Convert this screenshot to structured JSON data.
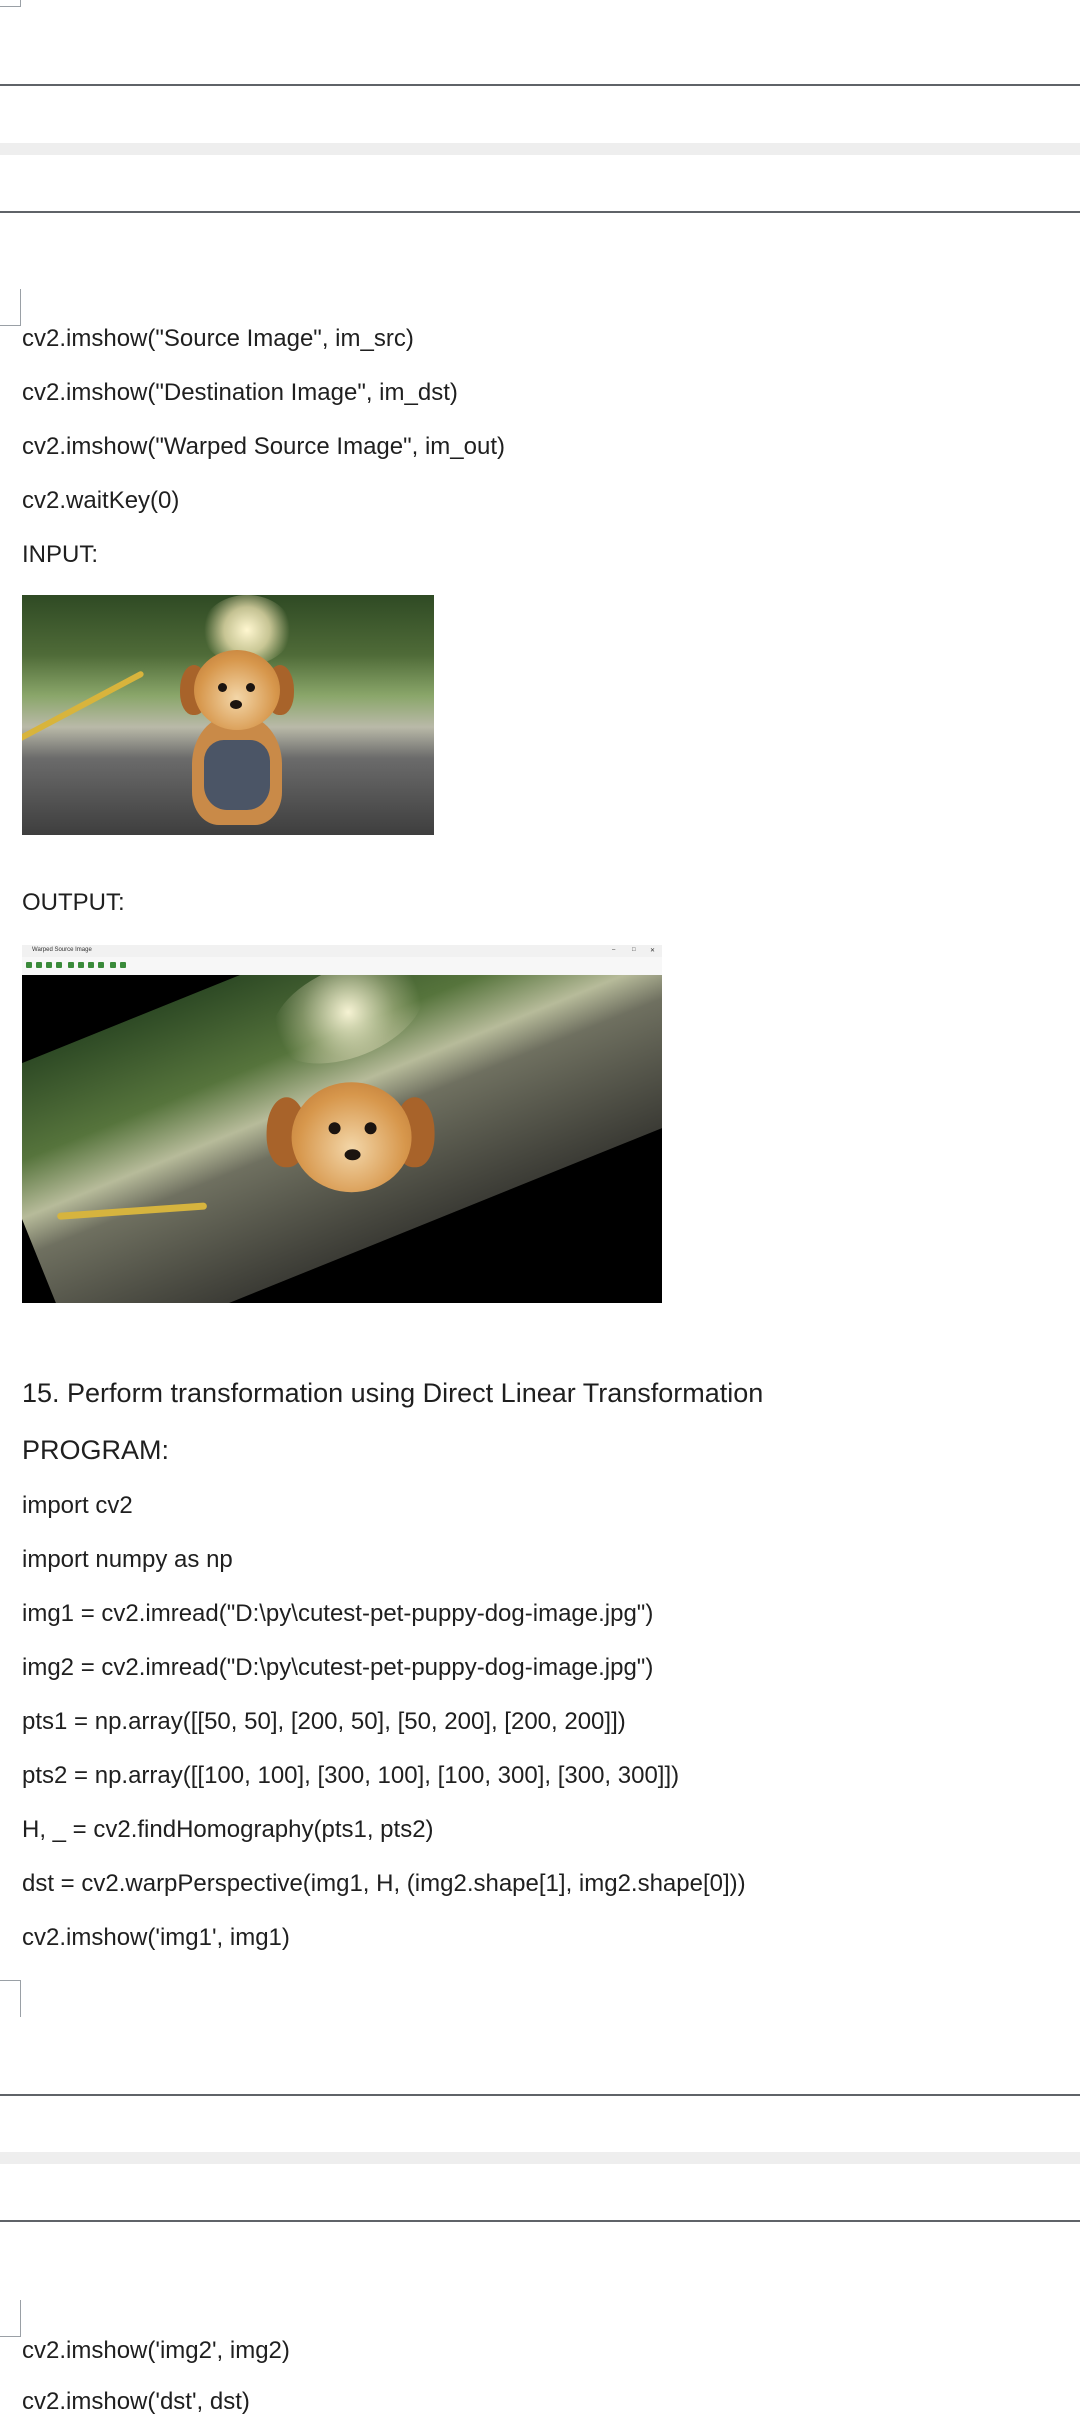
{
  "page1": {
    "lines": [
      "cv2.imshow(\"Source Image\", im_src)",
      "cv2.imshow(\"Destination Image\", im_dst)",
      "cv2.imshow(\"Warped Source Image\", im_out)",
      "cv2.waitKey(0)",
      "INPUT:"
    ],
    "output_label": "OUTPUT:",
    "window": {
      "title": "Warped Source Image",
      "controls": [
        "–",
        "□",
        "✕"
      ]
    },
    "section_heading": "15. Perform transformation using Direct Linear Transformation",
    "program_label": "PROGRAM:",
    "code": [
      "import cv2",
      "import numpy as np",
      "img1 = cv2.imread(\"D:\\py\\cutest-pet-puppy-dog-image.jpg\")",
      "img2 = cv2.imread(\"D:\\py\\cutest-pet-puppy-dog-image.jpg\")",
      "pts1 = np.array([[50, 50], [200, 50], [50, 200], [200, 200]])",
      "pts2 = np.array([[100, 100], [300, 100], [100, 300], [300, 300]])",
      "H, _ = cv2.findHomography(pts1, pts2)",
      "dst = cv2.warpPerspective(img1, H, (img2.shape[1], img2.shape[0]))",
      "cv2.imshow('img1', img1)"
    ]
  },
  "page2": {
    "lines": [
      "cv2.imshow('img2', img2)",
      "cv2.imshow('dst', dst)"
    ]
  }
}
